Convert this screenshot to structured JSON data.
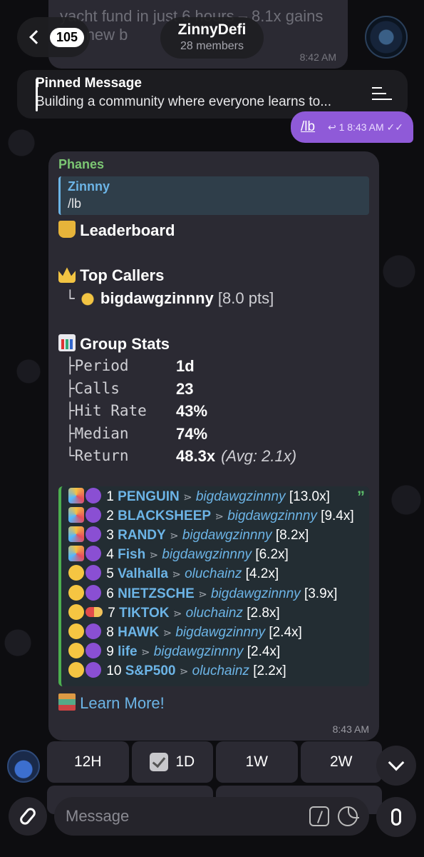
{
  "old_message": {
    "text": "yacht fund in just 6 hours – 8.1x gains the new b",
    "time": "8:42 AM"
  },
  "header": {
    "back_count": "105",
    "title": "ZinnyDefi",
    "members": "28 members"
  },
  "pinned": {
    "title": "Pinned Message",
    "text": "Building a community where everyone learns to..."
  },
  "my_message": {
    "text": "/lb",
    "reply_count": "1",
    "time": "8:43 AM"
  },
  "message": {
    "sender": "Phanes",
    "reply_to": {
      "name": "Zinnny",
      "text": "/lb"
    },
    "leaderboard_title": "Leaderboard",
    "top_callers_title": "Top Callers",
    "top_caller": {
      "prefix": "└",
      "name": "bigdawgzinnny",
      "points": "[8.0 pts]"
    },
    "group_stats_title": "Group Stats",
    "stats": [
      {
        "prefix": "├",
        "key": "Period",
        "value": "1d",
        "extra": ""
      },
      {
        "prefix": "├",
        "key": "Calls",
        "value": "23",
        "extra": ""
      },
      {
        "prefix": "├",
        "key": "Hit Rate",
        "value": "43%",
        "extra": ""
      },
      {
        "prefix": "├",
        "key": "Median",
        "value": "74%",
        "extra": ""
      },
      {
        "prefix": "└",
        "key": "Return",
        "value": "48.3x",
        "extra": "(Avg: 2.1x)"
      }
    ],
    "entries": [
      {
        "rank": "1",
        "token": "PENGUIN",
        "caller": "bigdawgzinnny",
        "mult": "[13.0x]",
        "icon": "party"
      },
      {
        "rank": "2",
        "token": "BLACKSHEEP",
        "caller": "bigdawgzinnny",
        "mult": "[9.4x]",
        "icon": "party"
      },
      {
        "rank": "3",
        "token": "RANDY",
        "caller": "bigdawgzinnny",
        "mult": "[8.2x]",
        "icon": "party"
      },
      {
        "rank": "4",
        "token": "Fish",
        "caller": "bigdawgzinnny",
        "mult": "[6.2x]",
        "icon": "party"
      },
      {
        "rank": "5",
        "token": "Valhalla",
        "caller": "oluchainz",
        "mult": "[4.2x]",
        "icon": "cool"
      },
      {
        "rank": "6",
        "token": "NIETZSCHE",
        "caller": "bigdawgzinnny",
        "mult": "[3.9x]",
        "icon": "cool"
      },
      {
        "rank": "7",
        "token": "TIKTOK",
        "caller": "oluchainz",
        "mult": "[2.8x]",
        "icon": "cool"
      },
      {
        "rank": "8",
        "token": "HAWK",
        "caller": "bigdawgzinnny",
        "mult": "[2.4x]",
        "icon": "cool"
      },
      {
        "rank": "9",
        "token": "life",
        "caller": "bigdawgzinnny",
        "mult": "[2.4x]",
        "icon": "cool"
      },
      {
        "rank": "10",
        "token": "S&P500",
        "caller": "oluchainz",
        "mult": "[2.2x]",
        "icon": "cool"
      }
    ],
    "learn_more": "Learn More!",
    "time": "8:43 AM"
  },
  "keyboard": {
    "buttons": [
      "12H",
      "1D",
      "1W",
      "2W"
    ],
    "selected": "1D"
  },
  "input": {
    "placeholder": "Message"
  },
  "colors": {
    "accent": "#8f5ad8",
    "link": "#6cb4e6",
    "sender": "#7cc673",
    "bubble": "#2b2a33"
  }
}
